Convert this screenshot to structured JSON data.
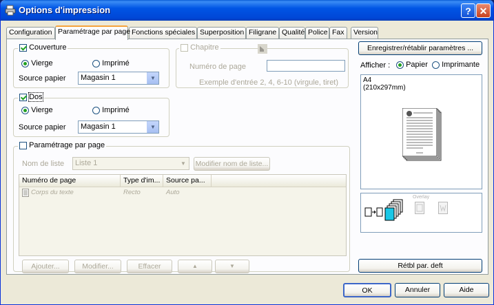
{
  "window": {
    "title": "Options d'impression"
  },
  "tabs": [
    "Configuration",
    "Paramétrage par page",
    "Fonctions spéciales",
    "Superposition",
    "Filigrane",
    "Qualité",
    "Police",
    "Fax",
    "Version"
  ],
  "active_tab": "Paramétrage par page",
  "cover": {
    "label": "Couverture",
    "checked": true,
    "radio_blank": "Vierge",
    "radio_printed": "Imprimé",
    "selected": "Vierge",
    "source_label": "Source papier",
    "source_value": "Magasin 1"
  },
  "chapter": {
    "label": "Chapitre",
    "checked": false,
    "page_label": "Numéro de page",
    "page_value": "",
    "example": "Exemple d'entrée 2, 4, 6-10 (virgule, tiret)"
  },
  "back": {
    "label": "Dos",
    "checked": true,
    "radio_blank": "Vierge",
    "radio_printed": "Imprimé",
    "selected": "Vierge",
    "source_label": "Source papier",
    "source_value": "Magasin 1"
  },
  "per_page": {
    "label": "Paramétrage par page",
    "checked": false,
    "list_name_label": "Nom de liste",
    "list_name_value": "Liste 1",
    "modify_button": "Modifier nom de liste...",
    "columns": [
      "Numéro de page",
      "Type d'im...",
      "Source pa..."
    ],
    "rows": [
      {
        "page": "Corps du texte",
        "type": "Recto",
        "source": "Auto"
      }
    ],
    "buttons": {
      "add": "Ajouter...",
      "modify": "Modifier...",
      "delete": "Effacer",
      "up": "▲",
      "down": "▼"
    }
  },
  "right": {
    "save_button": "Enregistrer/rétablir paramètres ...",
    "display_label": "Afficher :",
    "radio_paper": "Papier",
    "radio_printer": "Imprimante",
    "display_selected": "Papier",
    "paper_size": "A4",
    "paper_dims": "(210x297mm)",
    "overlay_label": "Overlay",
    "reset_button": "Rétbl par. deft"
  },
  "footer": {
    "ok": "OK",
    "cancel": "Annuler",
    "help": "Aide"
  },
  "colors": {
    "titlebar": "#0055e5",
    "face": "#ece9d8",
    "panel": "#fcfcfe",
    "tab_highlight": "#f5a33b",
    "check": "#21a121"
  }
}
